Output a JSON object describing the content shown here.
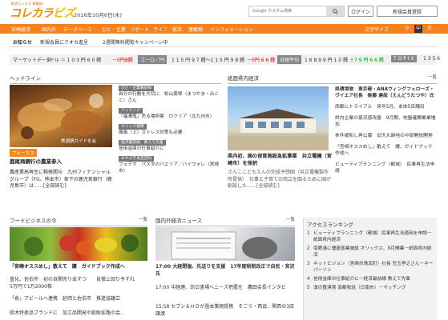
{
  "header": {
    "logo_sub": "経営ビジネス 戦略誌",
    "logo_part1": "コレカラ",
    "logo_part2": "ビズ",
    "date": "2016年10月6日(木)",
    "search_placeholder": "Google カスタム検索",
    "search_icon": "search-icon",
    "login_label": "ログイン",
    "register_label": "新規会員登録"
  },
  "nav": {
    "items": [
      "宮崎経済",
      "国内外",
      "データベース",
      "ひと・企業",
      "リポート",
      "ライフ",
      "就活",
      "連載物",
      "インフォメーション"
    ],
    "font_size_label": "文字サイズ",
    "sizes": [
      "小",
      "中",
      "大"
    ]
  },
  "notice": {
    "label": "お知らせ",
    "items": [
      "新規会員にクオカ進呈",
      "2週間無料閲覧キャンペーン中"
    ]
  },
  "market": {
    "label": "マーケットデータ",
    "dollar": "1ドル ＝ 1 0 3 円 6 0 銭",
    "dollar_change": "－0円8銭",
    "euro_tag": "ユーロ／円",
    "euro": "1 1 5 円 9 7 銭～1 1 5 円 9 8 銭",
    "euro_change": "－0円 6 6 銭",
    "nikkei_tag": "日経平均",
    "nikkei": "1 6 8 9 9 円 1 0 銭",
    "nikkei_change": "＋7 9 円 6 6 銭",
    "topix_tag": "T O P I X",
    "topix": "1 3 5 6"
  },
  "headline": {
    "title": "ヘッドライン",
    "photo_caption": "美酒鍋ガイドを会",
    "category": "フォーカス",
    "main_title": "鹿尾商鋼行の農業参入",
    "body": "農産業高再生に積極閲与　九州フィナンシャルグループ（FG、熊本市）傘下の鹿児島銀行（鹿児島市）は……[全部読む]"
  },
  "side_news": [
    {
      "cat": "ひと・企業最前線",
      "text": "自分の行動を大切に　松山美琴（まつやま・みこと）さん"
    },
    {
      "cat": "マッチング",
      "text": "「福澤塩」売る場所案　ロクリア（北九州市）"
    },
    {
      "cat": "クリック健康",
      "text": "痛風（上）ストレス対策も必要"
    },
    {
      "cat": "経済最前線　教えて先輩",
      "text": "信用金庫の仕事紹介に"
    },
    {
      "cat": "みやざき食品百科",
      "text": "フェデマ　パスタのパエリア／ハイウォレ（宮崎市）"
    }
  ],
  "local": {
    "title": "紙面県内経済",
    "more": "一覧",
    "feature_title": "県内初、国の保育施設急拡事業　共立電機（宮崎市）を採択",
    "feature_body": "さんここどもえんの完成予想図（共立電機製作所提供）　仕事と子育ての両立を図るために国が創設した……[全部読む]",
    "items": [
      "県環境旅　東京都・ANAウィングフェローズ・ヴイエア社長　後藤 達哉（えんどうたつや）氏",
      "西都にトライアル　来年5月、本体5店舗目",
      "県内企業の景況感改善　9月期、地盤確開業業増加",
      "条件緩和し再公募　旧大丸跡地の中部開放開発",
      "「宮崎オススめし」散えて　譲、ガイドブック作成へ",
      "ビューティプランニング（都城）　民事再生法申請"
    ]
  },
  "food": {
    "title": "フードビジネスの今",
    "more": "一覧",
    "item1": "「宮崎オススめし」散えて　譲　ガイドブック作成へ",
    "item2": "曇化、佐伯市　初の自関売り本ずつ　5万円で1万2000株",
    "item3": "自慢上回り予ずれ",
    "item4": "「食」アピールへ連携　延岡と佐伯市　推進協議立",
    "item5": "県木特産品ブランドに　加工品開発や飲販拡路の会…"
  },
  "intl": {
    "title": "国内外経済ニュース",
    "more": "一覧",
    "items": [
      "17:00 大経閉塩、先送りを支援　17年度税制改正で自民・宮沢氏",
      "17:00 中経連、訪日書場へニーズ把握を　農田会長インタビ",
      "15:58 セブン＆ＨＤが過本業務提携　そごう・西武、関西の3店譲渡"
    ]
  },
  "ranking": {
    "title": "アクセスランキング",
    "items": [
      "ビューティプランニング（都城）民事再生法適用を申請－紙面県内経済",
      "南郷港に優盛蒸業施設 オリックス、9月開業－紙面県内経済",
      "ネットビジョン（宮崎市清武町）社長 兒玉亭之さん－キーパーソン",
      "信用金庫の仕事紹介に－経済最前線 教えて先輩",
      "漢の整漠賞 南都牧話（日南市）－マッチング"
    ]
  }
}
